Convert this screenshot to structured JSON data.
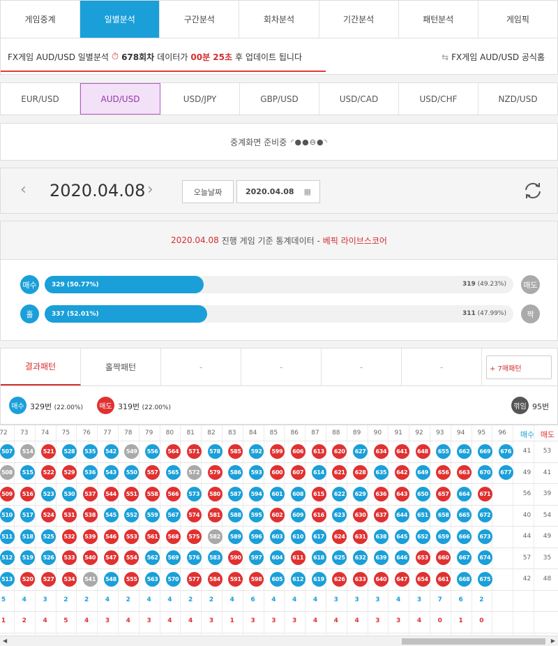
{
  "nav_tabs": [
    "게임중계",
    "일별분석",
    "구간분석",
    "회차분석",
    "기간분석",
    "패턴분석",
    "게임픽"
  ],
  "active_tab_index": 1,
  "info_bar": {
    "prefix": "FX게임 AUD/USD 일별분석",
    "round": "678회차",
    "mid": "데이터가",
    "timer": "00분 25초",
    "suffix": "후 업데이트 됩니다",
    "official_link": "FX게임 AUD/USD 공식홈"
  },
  "pairs": [
    "EUR/USD",
    "AUD/USD",
    "USD/JPY",
    "GBP/USD",
    "USD/CAD",
    "USD/CHF",
    "NZD/USD"
  ],
  "active_pair_index": 1,
  "prep_text": "중계화면 준비중",
  "date_bar": {
    "date": "2020.04.08",
    "today_button": "오늘날짜",
    "date_input": "2020.04.08"
  },
  "stats": {
    "head_date": "2020.04.08",
    "head_text": "진행 게임 기준 통계데이터 -",
    "head_brand": "베픽 라이브스코어",
    "rows": [
      {
        "left_label": "매수",
        "left_value": "329 (50.77%)",
        "fraction": 0.5077,
        "right_value": "319",
        "right_pct": "(49.23%)",
        "right_label": "매도"
      },
      {
        "left_label": "홀",
        "left_value": "337 (52.01%)",
        "fraction": 0.5201,
        "right_value": "311",
        "right_pct": "(47.99%)",
        "right_label": "짝"
      }
    ]
  },
  "pattern_tabs": [
    "결과패턴",
    "홀짝패턴",
    "-",
    "-",
    "-",
    "-"
  ],
  "seven_button": "+ 7매패턴",
  "summary": {
    "buy_label": "매수",
    "buy_count": "329번",
    "buy_pct": "(22.00%)",
    "sell_label": "매도",
    "sell_count": "319번",
    "sell_pct": "(22.00%)",
    "bounce_label": "꺾임",
    "bounce_count": "95번"
  },
  "colors": {
    "blue": "#1a9fd8",
    "red": "#e03131",
    "gray": "#a9a9a9",
    "accent": "#1a9fd8"
  },
  "grid": {
    "columns": [
      "72",
      "73",
      "74",
      "75",
      "76",
      "77",
      "78",
      "79",
      "80",
      "81",
      "82",
      "83",
      "84",
      "85",
      "86",
      "87",
      "88",
      "89",
      "90",
      "91",
      "92",
      "93",
      "94",
      "95",
      "96"
    ],
    "side_headers": [
      "매수",
      "매도"
    ],
    "side_values": [
      [
        41,
        53
      ],
      [
        49,
        41
      ],
      [
        56,
        39
      ],
      [
        40,
        54
      ],
      [
        44,
        49
      ],
      [
        57,
        35
      ],
      [
        42,
        48
      ]
    ],
    "cells": [
      [
        "507B",
        "514G",
        "521R",
        "528B",
        "535B",
        "542B",
        "549G",
        "556B",
        "564R",
        "571R",
        "578B",
        "585R",
        "592B",
        "599R",
        "606R",
        "613R",
        "620R",
        "627B",
        "634R",
        "641R",
        "648R",
        "655B",
        "662B",
        "669B",
        "676B"
      ],
      [
        "508G",
        "515B",
        "522R",
        "529R",
        "536B",
        "543B",
        "550B",
        "557R",
        "565B",
        "572G",
        "579R",
        "586B",
        "593B",
        "600R",
        "607R",
        "614B",
        "621R",
        "628R",
        "635B",
        "642R",
        "649B",
        "656R",
        "663R",
        "670B",
        "677B"
      ],
      [
        "509R",
        "516R",
        "523B",
        "530B",
        "537R",
        "544R",
        "551R",
        "558R",
        "566R",
        "573B",
        "580R",
        "587B",
        "594B",
        "601B",
        "608B",
        "615R",
        "622B",
        "629B",
        "636R",
        "643R",
        "650B",
        "657R",
        "664B",
        "671R",
        ""
      ],
      [
        "510B",
        "517B",
        "524R",
        "531R",
        "538R",
        "545B",
        "552B",
        "559B",
        "567B",
        "574R",
        "581R",
        "588B",
        "595B",
        "602R",
        "609B",
        "616R",
        "623B",
        "630R",
        "637R",
        "644B",
        "651B",
        "658B",
        "665B",
        "672B",
        ""
      ],
      [
        "511B",
        "518B",
        "525B",
        "532R",
        "539R",
        "546R",
        "553R",
        "561R",
        "568R",
        "575R",
        "582G",
        "589B",
        "596B",
        "603B",
        "610B",
        "617B",
        "624R",
        "631R",
        "638B",
        "645B",
        "652B",
        "659B",
        "666B",
        "673B",
        ""
      ],
      [
        "512B",
        "519B",
        "526B",
        "533R",
        "540R",
        "547R",
        "554R",
        "562B",
        "569B",
        "576B",
        "583B",
        "590R",
        "597B",
        "604B",
        "611R",
        "618B",
        "625B",
        "632B",
        "639B",
        "646B",
        "653R",
        "660R",
        "667B",
        "674B",
        ""
      ],
      [
        "513B",
        "520R",
        "527R",
        "534R",
        "541G",
        "548B",
        "555R",
        "563B",
        "570B",
        "577R",
        "584R",
        "591R",
        "598R",
        "605B",
        "612B",
        "619B",
        "626R",
        "633R",
        "640R",
        "647R",
        "654R",
        "661R",
        "668B",
        "675B",
        ""
      ]
    ],
    "buy_counts": [
      "5",
      "4",
      "3",
      "2",
      "2",
      "4",
      "2",
      "4",
      "4",
      "2",
      "2",
      "4",
      "6",
      "4",
      "4",
      "4",
      "3",
      "3",
      "3",
      "4",
      "3",
      "7",
      "6",
      "2",
      ""
    ],
    "sell_counts": [
      "1",
      "2",
      "4",
      "5",
      "4",
      "3",
      "4",
      "3",
      "4",
      "4",
      "3",
      "1",
      "3",
      "3",
      "3",
      "4",
      "4",
      "4",
      "3",
      "3",
      "4",
      "0",
      "1",
      "0",
      ""
    ]
  }
}
